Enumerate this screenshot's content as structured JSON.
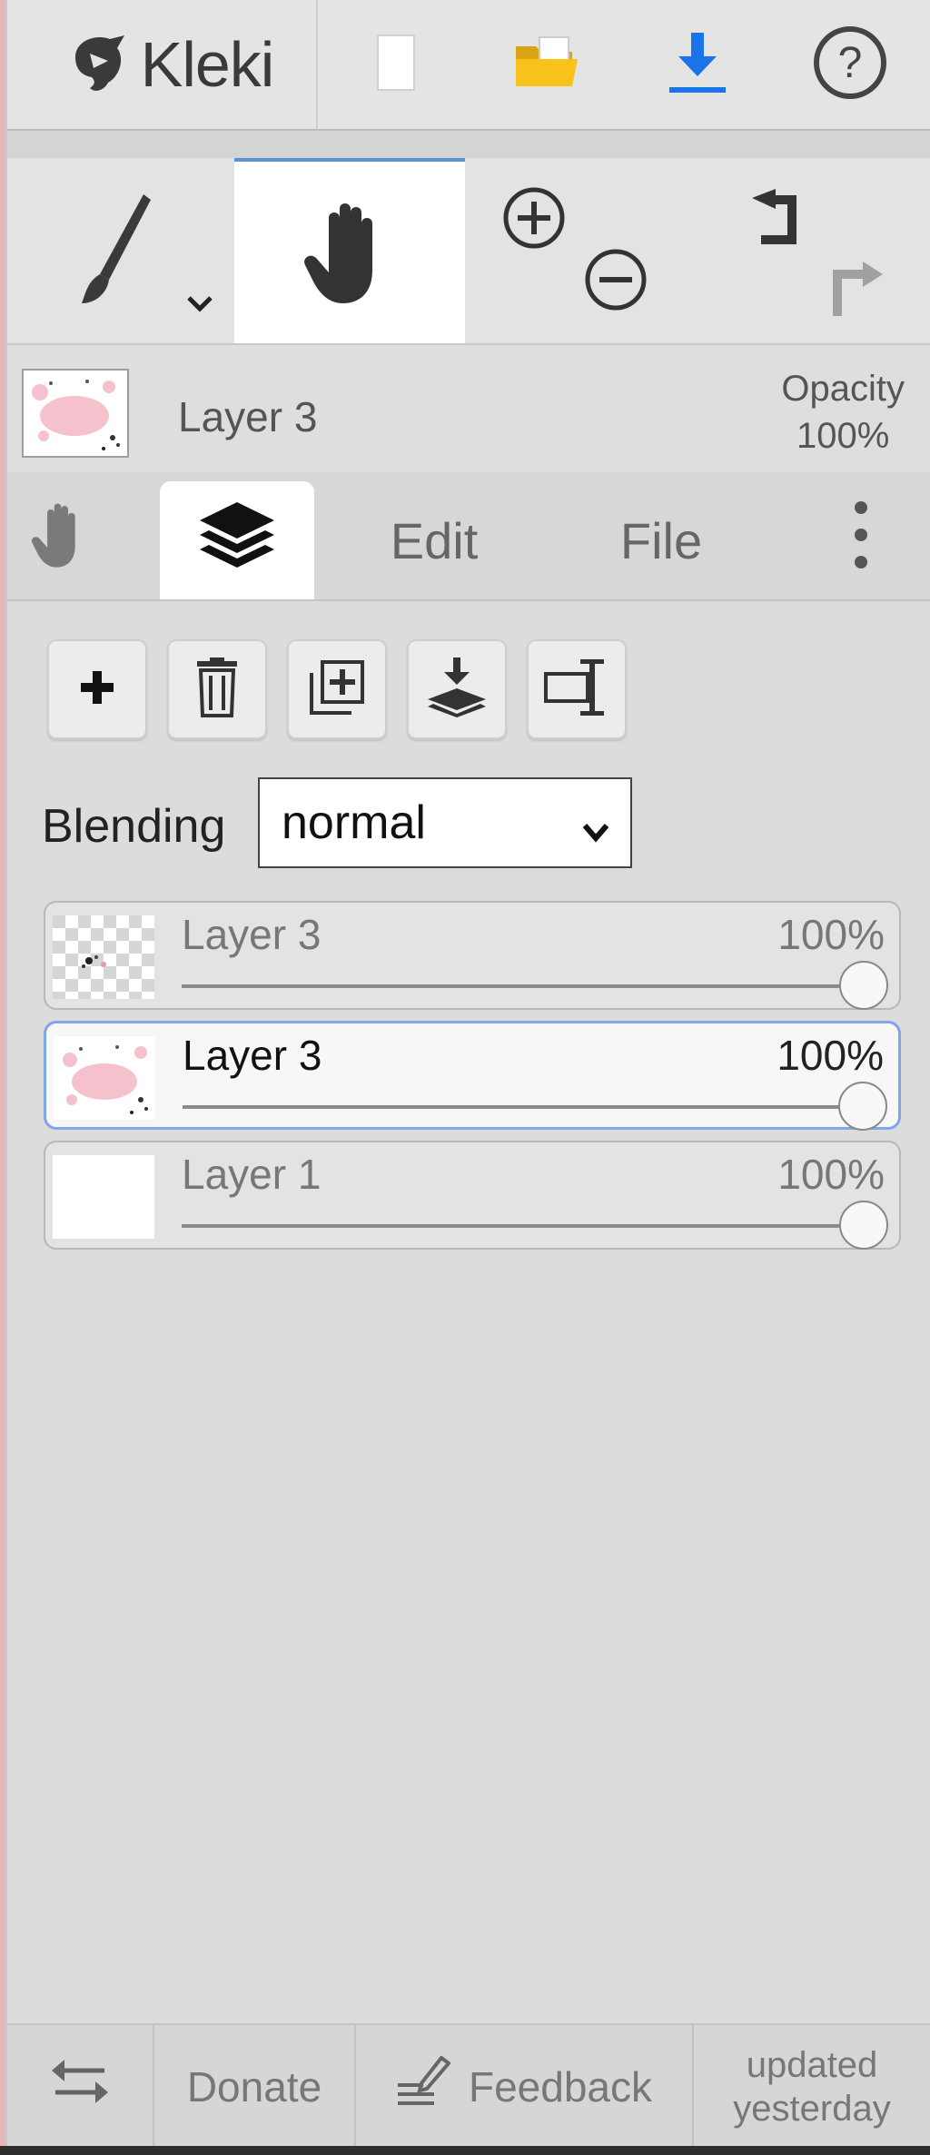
{
  "app": {
    "name": "Kleki"
  },
  "top_icons": [
    "new-image-icon",
    "open-folder-icon",
    "download-icon",
    "help-icon"
  ],
  "tools": {
    "brush": "brush-icon",
    "hand": "hand-icon",
    "zoom_in": "zoom-in-icon",
    "zoom_out": "zoom-out-icon",
    "undo": "undo-icon",
    "redo": "redo-icon"
  },
  "current_layer": {
    "name": "Layer 3",
    "opacity_label": "Opacity",
    "opacity_value": "100%"
  },
  "tabs": [
    {
      "label": "",
      "icon": "hand-icon"
    },
    {
      "label": "",
      "icon": "layers-icon",
      "active": true
    },
    {
      "label": "Edit"
    },
    {
      "label": "File"
    },
    {
      "label": "",
      "icon": "more-vertical-icon"
    }
  ],
  "layer_actions": [
    "add-layer-icon",
    "delete-layer-icon",
    "duplicate-layer-icon",
    "merge-down-icon",
    "rename-layer-icon"
  ],
  "blending": {
    "label": "Blending",
    "value": "normal"
  },
  "layers": [
    {
      "name": "Layer 3",
      "opacity": "100%",
      "selected": false,
      "thumb": "transparent"
    },
    {
      "name": "Layer 3",
      "opacity": "100%",
      "selected": true,
      "thumb": "pink"
    },
    {
      "name": "Layer 1",
      "opacity": "100%",
      "selected": false,
      "thumb": "white"
    }
  ],
  "footer": {
    "donate": "Donate",
    "feedback": "Feedback",
    "updated_line1": "updated",
    "updated_line2": "yesterday"
  },
  "colors": {
    "accent_blue": "#1a73e8",
    "folder_yellow": "#f7c21a",
    "selected_border": "#7fa6e8"
  }
}
